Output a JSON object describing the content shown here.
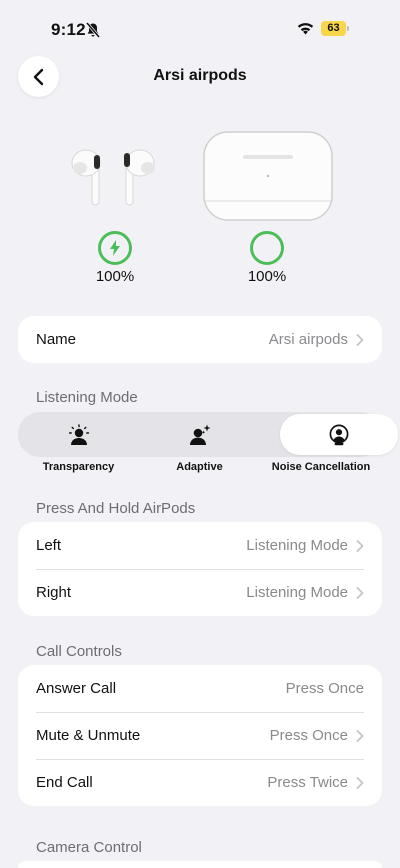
{
  "status_bar": {
    "time": "9:12",
    "battery": "63"
  },
  "nav": {
    "title": "Arsi airpods"
  },
  "devices": {
    "earbuds_battery": "100%",
    "case_battery": "100%"
  },
  "name_row": {
    "label": "Name",
    "value": "Arsi airpods"
  },
  "listening_mode": {
    "header": "Listening Mode",
    "options": [
      "Transparency",
      "Adaptive",
      "Noise Cancellation"
    ],
    "selected": "Noise Cancellation"
  },
  "press_hold": {
    "header": "Press And Hold AirPods",
    "rows": [
      {
        "label": "Left",
        "value": "Listening Mode"
      },
      {
        "label": "Right",
        "value": "Listening Mode"
      }
    ]
  },
  "call_controls": {
    "header": "Call Controls",
    "rows": [
      {
        "label": "Answer Call",
        "value": "Press Once"
      },
      {
        "label": "Mute & Unmute",
        "value": "Press Once"
      },
      {
        "label": "End Call",
        "value": "Press Twice"
      }
    ]
  },
  "camera_control": {
    "header": "Camera Control"
  },
  "colors": {
    "accent_green": "#4cbe59",
    "battery_yellow": "#f7d64a",
    "background": "#f2f2f6"
  }
}
